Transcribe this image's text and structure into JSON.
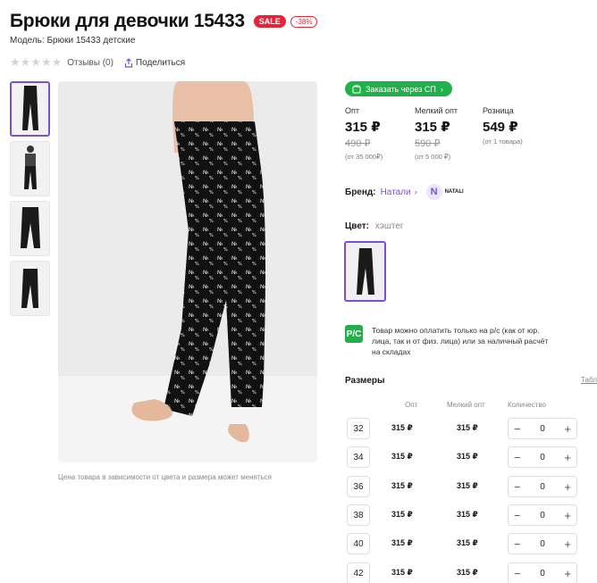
{
  "product": {
    "title": "Брюки для девочки 15433",
    "sale_badge": "SALE",
    "discount_badge": "-38%",
    "model": "Модель: Брюки 15433 детские",
    "stars": "★★★★★",
    "reviews": "Отзывы (0)",
    "share": "Поделиться",
    "caption": "Цена товара в зависимости от цвета и размера может меняться"
  },
  "order_button": "Заказать через СП",
  "prices": [
    {
      "label": "Опт",
      "price": "315 ₽",
      "old": "490 ₽",
      "note": "(от 35 000₽)"
    },
    {
      "label": "Мелкий опт",
      "price": "315 ₽",
      "old": "590 ₽",
      "note": "(от 5 000 ₽)"
    },
    {
      "label": "Розница",
      "price": "549 ₽",
      "old": "",
      "note": "(от 1 товара)"
    }
  ],
  "brand": {
    "label": "Бренд:",
    "name": "Натали",
    "logo_text": "NATALI",
    "logo_letter": "N"
  },
  "color": {
    "label": "Цвет:",
    "value": "хэштег"
  },
  "payment": {
    "icon_text": "P/C",
    "text": "Товар можно оплатить только на р/с (как от юр. лица, так и от физ. лица) или за наличный расчёт на складах"
  },
  "sizes": {
    "title": "Размеры",
    "table_link": "Табл",
    "headers": {
      "opt": "Опт",
      "small": "Мелкий опт",
      "qty": "Количество"
    },
    "rows": [
      {
        "size": "32",
        "opt": "315 ₽",
        "small": "315 ₽",
        "qty": "0"
      },
      {
        "size": "34",
        "opt": "315 ₽",
        "small": "315 ₽",
        "qty": "0"
      },
      {
        "size": "36",
        "opt": "315 ₽",
        "small": "315 ₽",
        "qty": "0"
      },
      {
        "size": "38",
        "opt": "315 ₽",
        "small": "315 ₽",
        "qty": "0"
      },
      {
        "size": "40",
        "opt": "315 ₽",
        "small": "315 ₽",
        "qty": "0"
      },
      {
        "size": "42",
        "opt": "315 ₽",
        "small": "315 ₽",
        "qty": "0"
      }
    ],
    "minus": "−",
    "plus": "+"
  },
  "colors": {
    "accent": "#7a4fd6",
    "sale": "#e52535",
    "green": "#22b04b"
  }
}
